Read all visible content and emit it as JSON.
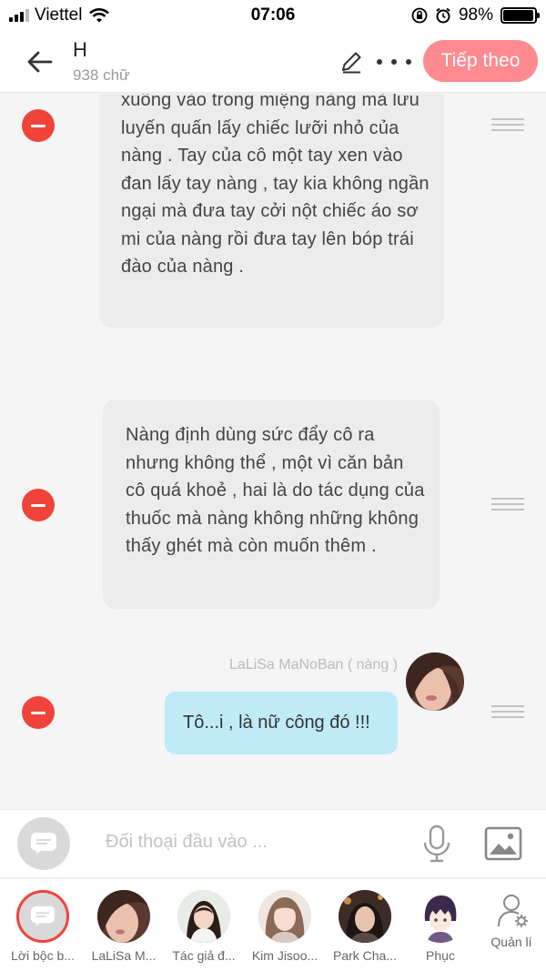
{
  "status_bar": {
    "carrier": "Viettel",
    "time": "07:06",
    "battery": "98%",
    "battery_level": 0.98
  },
  "header": {
    "title": "H",
    "subtitle": "938 chữ",
    "next_label": "Tiếp theo"
  },
  "messages": [
    {
      "text": "xuống vào trong miệng nàng mà lưu luyến quấn lấy chiếc lưỡi nhỏ của nàng . Tay của cô một tay xen vào đan lấy tay nàng , tay kia không ngần ngại mà đưa tay cởi nột chiếc áo sơ mi của nàng rồi đưa tay lên bóp trái đào của nàng ."
    },
    {
      "text": "Nàng định dùng sức đẩy cô ra nhưng không thể , một vì căn bản cô quá khoẻ , hai là do tác dụng của thuốc mà nàng không những không thấy ghét mà còn muốn thêm ."
    },
    {
      "speaker": "LaLiSa MaNoBan ( nàng )",
      "text": "Tô...i , là nữ công đó !!!"
    }
  ],
  "input": {
    "placeholder": "Đối thoại đầu vào ..."
  },
  "characters": [
    {
      "label": "Lời bộc b..."
    },
    {
      "label": "LaLiSa M..."
    },
    {
      "label": "Tác giả đ..."
    },
    {
      "label": "Kim Jisoo..."
    },
    {
      "label": "Park Cha..."
    },
    {
      "label": "Phục"
    }
  ],
  "manage_label": "Quản lí",
  "colors": {
    "accent": "#ff8a8f",
    "remove": "#f0433a",
    "bubble": "#ececec",
    "bubble_self": "#bfeaf8"
  }
}
